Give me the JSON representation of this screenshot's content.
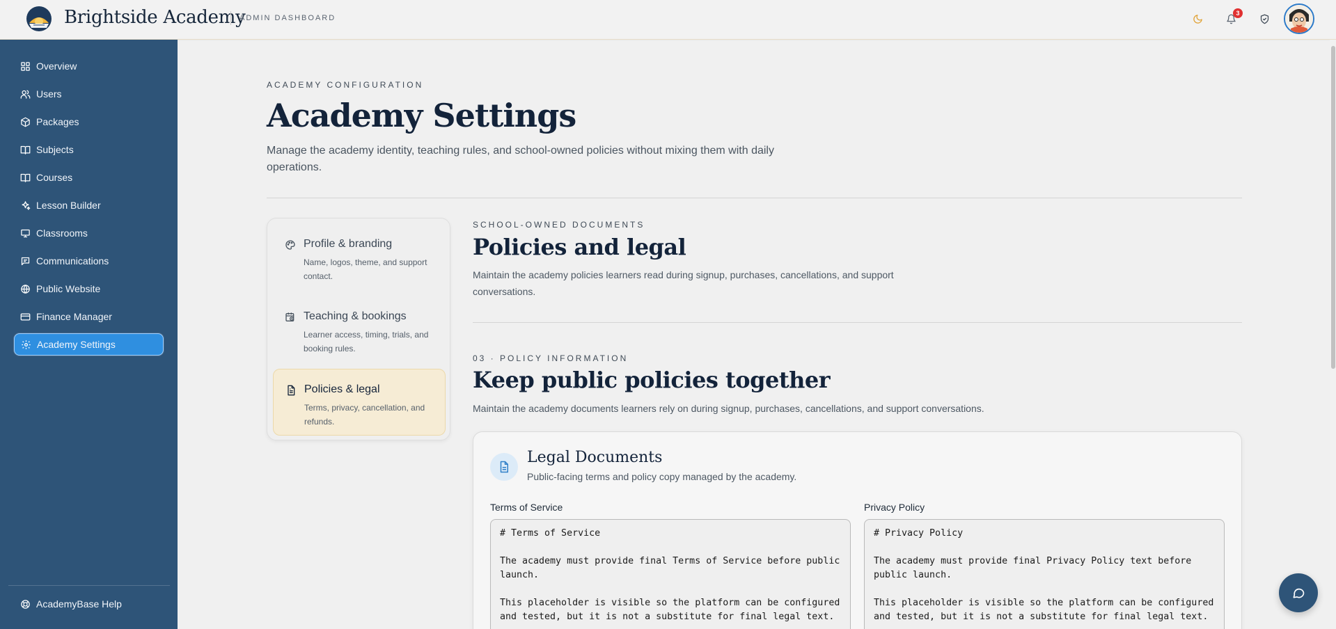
{
  "header": {
    "brand": "Brightside Academy",
    "subtitle": "ADMIN DASHBOARD",
    "notification_count": "3",
    "icons": [
      "moon-icon",
      "bell-icon",
      "shield-check-icon",
      "avatar"
    ]
  },
  "sidebar": {
    "items": [
      {
        "label": "Overview",
        "icon": "grid-icon"
      },
      {
        "label": "Users",
        "icon": "users-icon"
      },
      {
        "label": "Packages",
        "icon": "package-icon"
      },
      {
        "label": "Subjects",
        "icon": "book-open-icon"
      },
      {
        "label": "Courses",
        "icon": "book-icon"
      },
      {
        "label": "Lesson Builder",
        "icon": "sparkles-icon"
      },
      {
        "label": "Classrooms",
        "icon": "monitor-icon"
      },
      {
        "label": "Communications",
        "icon": "message-icon"
      },
      {
        "label": "Public Website",
        "icon": "globe-icon"
      },
      {
        "label": "Finance Manager",
        "icon": "credit-card-icon"
      },
      {
        "label": "Academy Settings",
        "icon": "gear-icon",
        "active": true
      }
    ],
    "help": "AcademyBase Help"
  },
  "page": {
    "eyebrow": "ACADEMY CONFIGURATION",
    "title": "Academy Settings",
    "description": "Manage the academy identity, teaching rules, and school-owned policies without mixing them with daily operations."
  },
  "settings_nav": [
    {
      "title": "Profile & branding",
      "desc": "Name, logos, theme, and support contact.",
      "icon": "palette-icon"
    },
    {
      "title": "Teaching & bookings",
      "desc": "Learner access, timing, trials, and booking rules.",
      "icon": "calendar-clock-icon"
    },
    {
      "title": "Policies & legal",
      "desc": "Terms, privacy, cancellation, and refunds.",
      "icon": "document-icon",
      "active": true
    }
  ],
  "section": {
    "eyebrow": "SCHOOL-OWNED DOCUMENTS",
    "title": "Policies and legal",
    "description": "Maintain the academy policies learners read during signup, purchases, cancellations, and support conversations."
  },
  "subsection": {
    "eyebrow": "03 · POLICY INFORMATION",
    "title": "Keep public policies together",
    "description": "Maintain the academy documents learners rely on during signup, purchases, cancellations, and support conversations."
  },
  "card": {
    "title": "Legal Documents",
    "subtitle": "Public-facing terms and policy copy managed by the academy.",
    "fields": [
      {
        "label": "Terms of Service",
        "value": "# Terms of Service\n\nThe academy must provide final Terms of Service before public launch.\n\nThis placeholder is visible so the platform can be configured and tested, but it is not a substitute for final legal text."
      },
      {
        "label": "Privacy Policy",
        "value": "# Privacy Policy\n\nThe academy must provide final Privacy Policy text before public launch.\n\nThis placeholder is visible so the platform can be configured and tested, but it is not a substitute for final legal text."
      }
    ]
  },
  "colors": {
    "sidebar": "#2e5478",
    "active": "#2f8fe0",
    "accent": "#e0a030",
    "badge": "#e03131"
  }
}
